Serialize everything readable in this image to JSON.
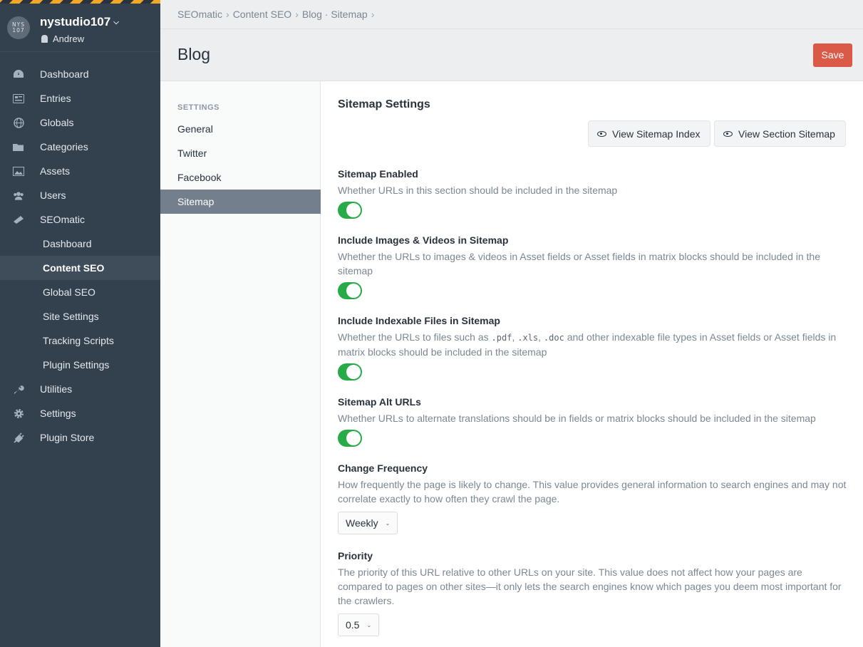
{
  "sidebar": {
    "site_name": "nystudio107",
    "user_name": "Andrew",
    "logo_text": "NYS 107",
    "nav": [
      {
        "label": "Dashboard",
        "icon": "dashboard-icon"
      },
      {
        "label": "Entries",
        "icon": "entries-icon"
      },
      {
        "label": "Globals",
        "icon": "globe-icon"
      },
      {
        "label": "Categories",
        "icon": "folder-icon"
      },
      {
        "label": "Assets",
        "icon": "image-icon"
      },
      {
        "label": "Users",
        "icon": "users-icon"
      },
      {
        "label": "SEOmatic",
        "icon": "seomatic-icon"
      },
      {
        "label": "Dashboard"
      },
      {
        "label": "Content SEO"
      },
      {
        "label": "Global SEO"
      },
      {
        "label": "Site Settings"
      },
      {
        "label": "Tracking Scripts"
      },
      {
        "label": "Plugin Settings"
      },
      {
        "label": "Utilities",
        "icon": "wrench-icon"
      },
      {
        "label": "Settings",
        "icon": "gear-icon"
      },
      {
        "label": "Plugin Store",
        "icon": "plug-icon"
      }
    ]
  },
  "header": {
    "breadcrumbs": [
      "SEOmatic",
      "Content SEO",
      "Blog · Sitemap"
    ],
    "title": "Blog",
    "save_label": "Save"
  },
  "settings_nav": {
    "heading": "SETTINGS",
    "items": [
      "General",
      "Twitter",
      "Facebook",
      "Sitemap"
    ]
  },
  "content": {
    "title": "Sitemap Settings",
    "buttons": {
      "view_index": "View Sitemap Index",
      "view_section": "View Section Sitemap"
    },
    "fields": {
      "sitemap_enabled": {
        "label": "Sitemap Enabled",
        "instructions": "Whether URLs in this section should be included in the sitemap",
        "value": "on"
      },
      "include_images": {
        "label": "Include Images & Videos in Sitemap",
        "instructions": "Whether the URLs to images & videos in Asset fields or Asset fields in matrix blocks should be included in the sitemap",
        "value": "on"
      },
      "indexable_files": {
        "label": "Include Indexable Files in Sitemap",
        "instr_1": "Whether the URLs to files such as ",
        "code_1": ".pdf",
        "sep_1": ", ",
        "code_2": ".xls",
        "sep_2": ", ",
        "code_3": ".doc",
        "instr_2": " and other indexable file types in Asset fields or Asset fields in matrix blocks should be included in the sitemap",
        "value": "on"
      },
      "alt_urls": {
        "label": "Sitemap Alt URLs",
        "instructions": "Whether URLs to alternate translations should be in fields or matrix blocks should be included in the sitemap",
        "value": "on"
      },
      "change_frequency": {
        "label": "Change Frequency",
        "instructions": "How frequently the page is likely to change. This value provides general information to search engines and may not correlate exactly to how often they crawl the page.",
        "value": "Weekly"
      },
      "priority": {
        "label": "Priority",
        "instructions": "The priority of this URL relative to other URLs on your site. This value does not affect how your pages are compared to pages on other sites—it only lets the search engines know which pages you deem most important for the crawlers.",
        "value": "0.5"
      }
    }
  },
  "colors": {
    "sidebar_bg": "#33404d",
    "accent_save": "#da5a47",
    "toggle_on": "#27ab48",
    "selected_nav": "#737f8c"
  }
}
